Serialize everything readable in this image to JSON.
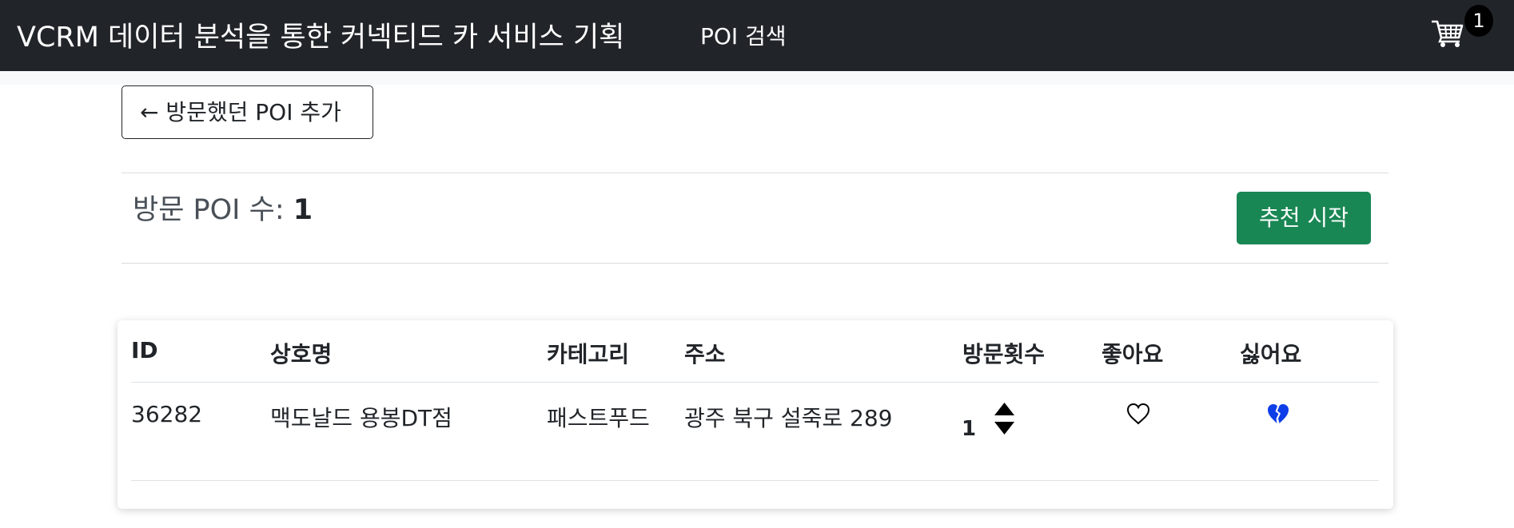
{
  "navbar": {
    "brand": "VCRM 데이터 분석을 통한 커넥티드 카 서비스 기획",
    "nav_link": "POI 검색",
    "cart_count": "1"
  },
  "back_button": "← 방문했던 POI 추가",
  "summary": {
    "label": "방문 POI 수:",
    "count": "1"
  },
  "start_button": "추천 시작",
  "table": {
    "headers": [
      "ID",
      "상호명",
      "카테고리",
      "주소",
      "방문횟수",
      "좋아요",
      "싫어요"
    ],
    "rows": [
      {
        "id": "36282",
        "name": "맥도날드 용봉DT점",
        "category": "패스트푸드",
        "address": "광주 북구 설죽로 289",
        "visits": "1",
        "liked": false,
        "disliked": true
      }
    ]
  },
  "colors": {
    "navbar_bg": "#212529",
    "primary_green": "#198754",
    "dislike_blue": "#0d3ee8"
  },
  "icons": {
    "cart": "shopping-cart-icon",
    "like": "heart-outline-icon",
    "dislike": "broken-heart-icon",
    "increment": "triangle-up-icon",
    "decrement": "triangle-down-icon"
  }
}
